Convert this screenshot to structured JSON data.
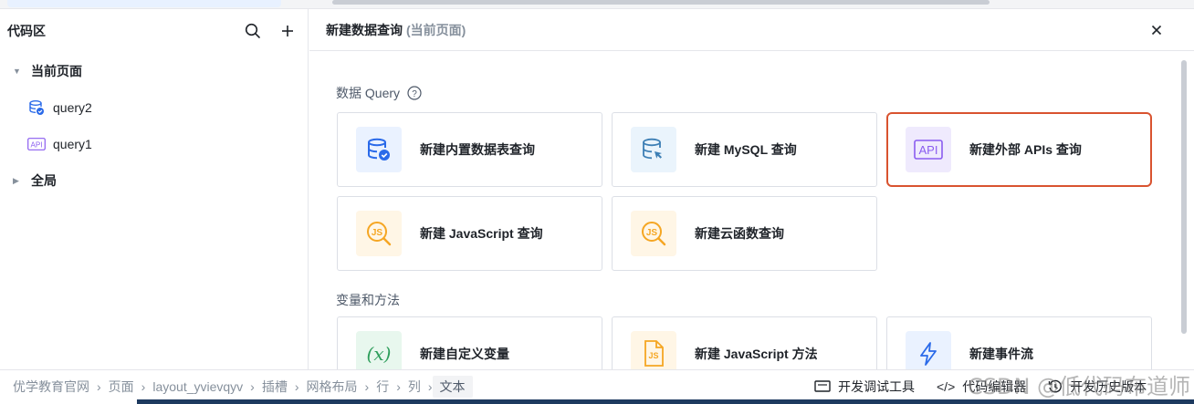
{
  "left_panel": {
    "title": "代码区",
    "groups": [
      {
        "label": "当前页面",
        "expanded": true
      },
      {
        "label": "全局",
        "expanded": false
      }
    ],
    "items": [
      {
        "label": "query2",
        "icon": "database-icon"
      },
      {
        "label": "query1",
        "icon": "api-icon"
      }
    ]
  },
  "dialog": {
    "title": "新建数据查询",
    "subtitle": "(当前页面)",
    "sections": [
      {
        "title": "数据 Query",
        "cards": [
          {
            "label": "新建内置数据表查询",
            "icon": "database-icon"
          },
          {
            "label": "新建 MySQL 查询",
            "icon": "mysql-icon"
          },
          {
            "label": "新建外部 APIs 查询",
            "icon": "api-icon",
            "selected": true
          },
          {
            "label": "新建 JavaScript 查询",
            "icon": "javascript-icon"
          },
          {
            "label": "新建云函数查询",
            "icon": "cloud-function-icon"
          }
        ]
      },
      {
        "title": "变量和方法",
        "cards": [
          {
            "label": "新建自定义变量",
            "icon": "variable-icon",
            "glyph": "(x)"
          },
          {
            "label": "新建 JavaScript 方法",
            "icon": "js-file-icon",
            "glyph": "JS"
          },
          {
            "label": "新建事件流",
            "icon": "lightning-icon"
          }
        ]
      }
    ]
  },
  "bottom_bar": {
    "breadcrumbs": [
      "优学教育官网",
      "页面",
      "layout_yvievqyv",
      "插槽",
      "网格布局",
      "行",
      "列",
      "文本"
    ],
    "tools": [
      {
        "label": "开发调试工具",
        "icon": "debug-icon"
      },
      {
        "label": "代码编辑器",
        "icon": "code-icon",
        "glyph": "</>"
      },
      {
        "label": "开发历史版本",
        "icon": "history-icon"
      }
    ]
  },
  "watermark": "CSDN @低代码布道师",
  "colors": {
    "accent": "#2a6ae9",
    "selected_border": "#d9532f",
    "purple": "#8a5cf0",
    "yellow": "#f5a623",
    "green": "#2e9e5b"
  }
}
